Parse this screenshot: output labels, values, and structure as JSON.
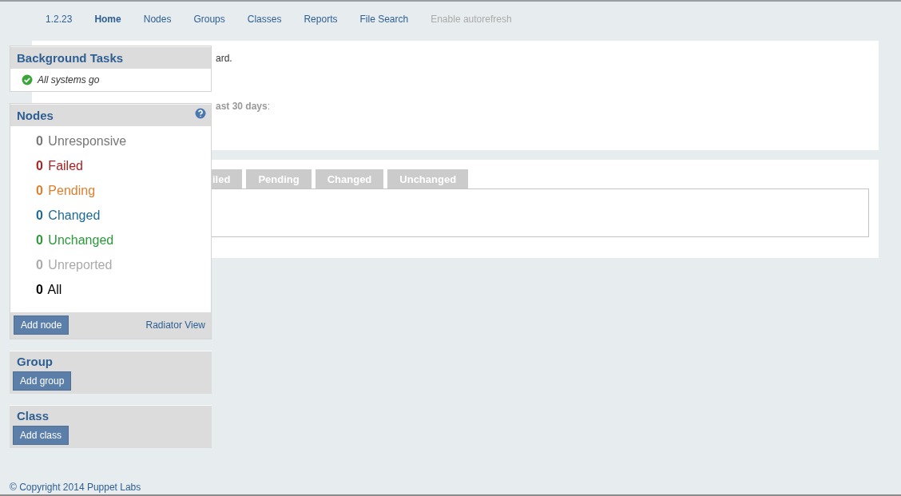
{
  "nav": [
    {
      "label": "1.2.23",
      "kind": "version",
      "selected": false
    },
    {
      "label": "Home",
      "kind": "link",
      "selected": true
    },
    {
      "label": "Nodes",
      "kind": "link",
      "selected": false
    },
    {
      "label": "Groups",
      "kind": "link",
      "selected": false
    },
    {
      "label": "Classes",
      "kind": "link",
      "selected": false
    },
    {
      "label": "Reports",
      "kind": "link",
      "selected": false
    },
    {
      "label": "File Search",
      "kind": "link",
      "selected": false
    },
    {
      "label": "Enable autorefresh",
      "kind": "toggle",
      "selected": false
    }
  ],
  "main": {
    "intro_text": "ard.",
    "summary_text": "**ast 30 days**:"
  },
  "tabs": [
    {
      "label": "iled",
      "selected": false
    },
    {
      "label": "Pending",
      "selected": false
    },
    {
      "label": "Changed",
      "selected": false
    },
    {
      "label": "Unchanged",
      "selected": false
    }
  ],
  "background_tasks": {
    "title": "Background Tasks",
    "status": "All systems go"
  },
  "nodes": {
    "title": "Nodes",
    "items": [
      {
        "count": "0",
        "label": "Unresponsive",
        "color": "#777777"
      },
      {
        "count": "0",
        "label": "Failed",
        "color": "#aa2222"
      },
      {
        "count": "0",
        "label": "Pending",
        "color": "#dd7f2c"
      },
      {
        "count": "0",
        "label": "Changed",
        "color": "#1d6a96"
      },
      {
        "count": "0",
        "label": "Unchanged",
        "color": "#2a9a3a"
      },
      {
        "count": "0",
        "label": "Unreported",
        "color": "#aaaaaa"
      },
      {
        "count": "0",
        "label": "All",
        "color": "#000000"
      }
    ],
    "button": "Add node",
    "link": "Radiator View"
  },
  "group": {
    "title": "Group",
    "button": "Add group"
  },
  "class": {
    "title": "Class",
    "button": "Add class"
  },
  "footer": "© Copyright 2014 Puppet Labs"
}
